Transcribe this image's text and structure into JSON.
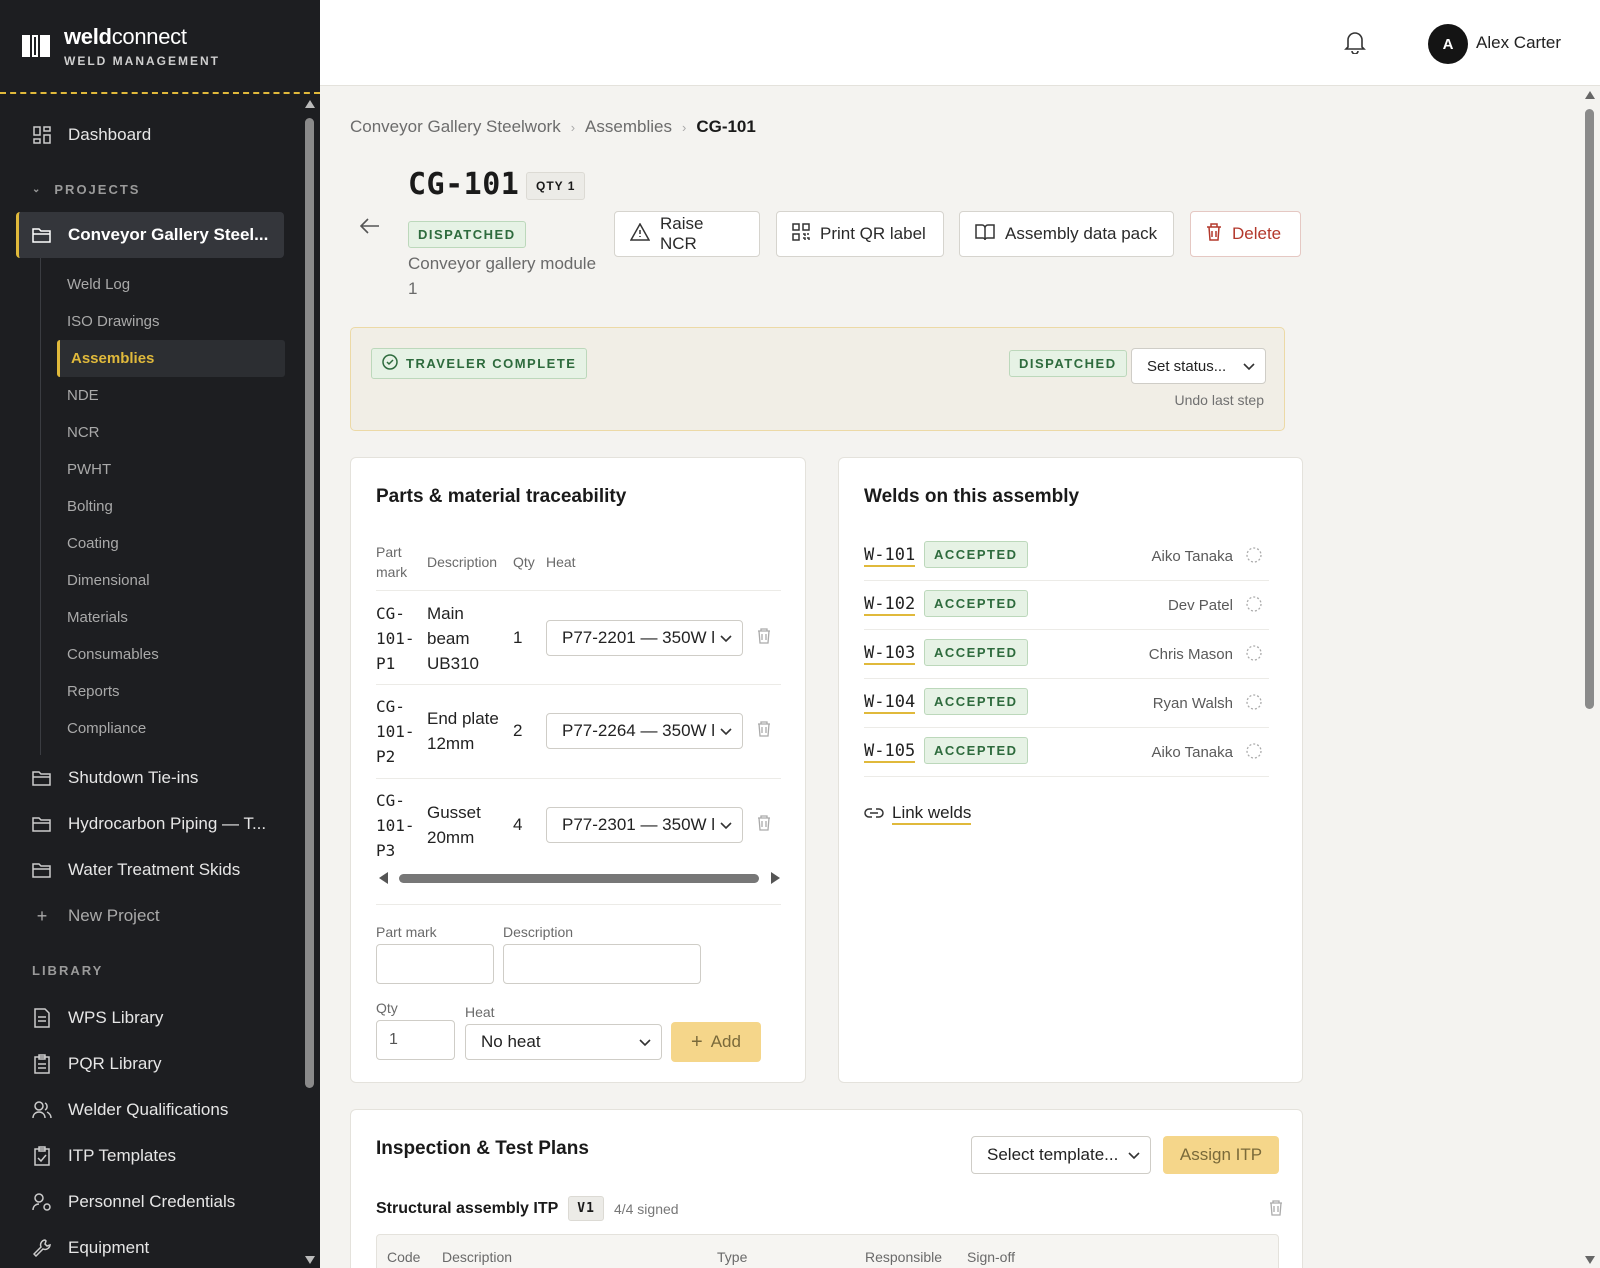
{
  "brand": {
    "name_bold": "weld",
    "name_rest": "connect",
    "subtitle": "WELD MANAGEMENT"
  },
  "nav": {
    "dashboard": "Dashboard",
    "projects_header": "PROJECTS",
    "active_project": "Conveyor Gallery Steel...",
    "sub_items": [
      "Weld Log",
      "ISO Drawings",
      "Assemblies",
      "NDE",
      "NCR",
      "PWHT",
      "Bolting",
      "Coating",
      "Dimensional",
      "Materials",
      "Consumables",
      "Reports",
      "Compliance"
    ],
    "projects": [
      "Shutdown Tie-ins",
      "Hydrocarbon Piping — T...",
      "Water Treatment Skids"
    ],
    "new_project": "New Project",
    "library_header": "LIBRARY",
    "library": [
      "WPS Library",
      "PQR Library",
      "Welder Qualifications",
      "ITP Templates",
      "Personnel Credentials",
      "Equipment"
    ]
  },
  "user": {
    "initial": "A",
    "name": "Alex Carter"
  },
  "breadcrumb": {
    "project": "Conveyor Gallery Steelwork",
    "section": "Assemblies",
    "current": "CG-101"
  },
  "assembly": {
    "id": "CG-101",
    "qty_badge": "QTY 1",
    "status": "DISPATCHED",
    "description": "Conveyor gallery module 1"
  },
  "actions": {
    "raise_ncr": "Raise NCR",
    "print_qr": "Print QR label",
    "data_pack": "Assembly data pack",
    "delete": "Delete"
  },
  "traveler": {
    "badge": "TRAVELER COMPLETE",
    "status": "DISPATCHED",
    "set_status": "Set status...",
    "undo": "Undo last step"
  },
  "parts": {
    "title": "Parts & material traceability",
    "headers": {
      "part_mark": "Part mark",
      "description": "Description",
      "qty": "Qty",
      "heat": "Heat"
    },
    "rows": [
      {
        "mark": [
          "CG-",
          "101-",
          "P1"
        ],
        "desc": [
          "Main",
          "beam",
          "UB310"
        ],
        "qty": "1",
        "heat": "P77-2201 — 350W l"
      },
      {
        "mark": [
          "CG-",
          "101-",
          "P2"
        ],
        "desc": [
          "End plate",
          "12mm"
        ],
        "qty": "2",
        "heat": "P77-2264 — 350W l"
      },
      {
        "mark": [
          "CG-",
          "101-",
          "P3"
        ],
        "desc": [
          "Gusset",
          "20mm"
        ],
        "qty": "4",
        "heat": "P77-2301 — 350W l"
      }
    ],
    "form": {
      "part_mark_label": "Part mark",
      "description_label": "Description",
      "qty_label": "Qty",
      "qty_value": "1",
      "heat_label": "Heat",
      "heat_value": "No heat",
      "add": "Add"
    }
  },
  "welds": {
    "title": "Welds on this assembly",
    "rows": [
      {
        "id": "W-101",
        "status": "ACCEPTED",
        "welder": "Aiko Tanaka"
      },
      {
        "id": "W-102",
        "status": "ACCEPTED",
        "welder": "Dev Patel"
      },
      {
        "id": "W-103",
        "status": "ACCEPTED",
        "welder": "Chris Mason"
      },
      {
        "id": "W-104",
        "status": "ACCEPTED",
        "welder": "Ryan Walsh"
      },
      {
        "id": "W-105",
        "status": "ACCEPTED",
        "welder": "Aiko Tanaka"
      }
    ],
    "link": "Link welds"
  },
  "itp": {
    "title": "Inspection & Test Plans",
    "template_placeholder": "Select template...",
    "assign": "Assign ITP",
    "plan_name": "Structural assembly ITP",
    "version": "V1",
    "signed": "4/4 signed",
    "headers": [
      "Code",
      "Description",
      "Type",
      "Responsible",
      "Sign-off"
    ]
  },
  "colors": {
    "accent": "#e0b93b",
    "sidebar": "#1d1e21",
    "success": "#2e6b3d",
    "danger": "#b3382c"
  }
}
